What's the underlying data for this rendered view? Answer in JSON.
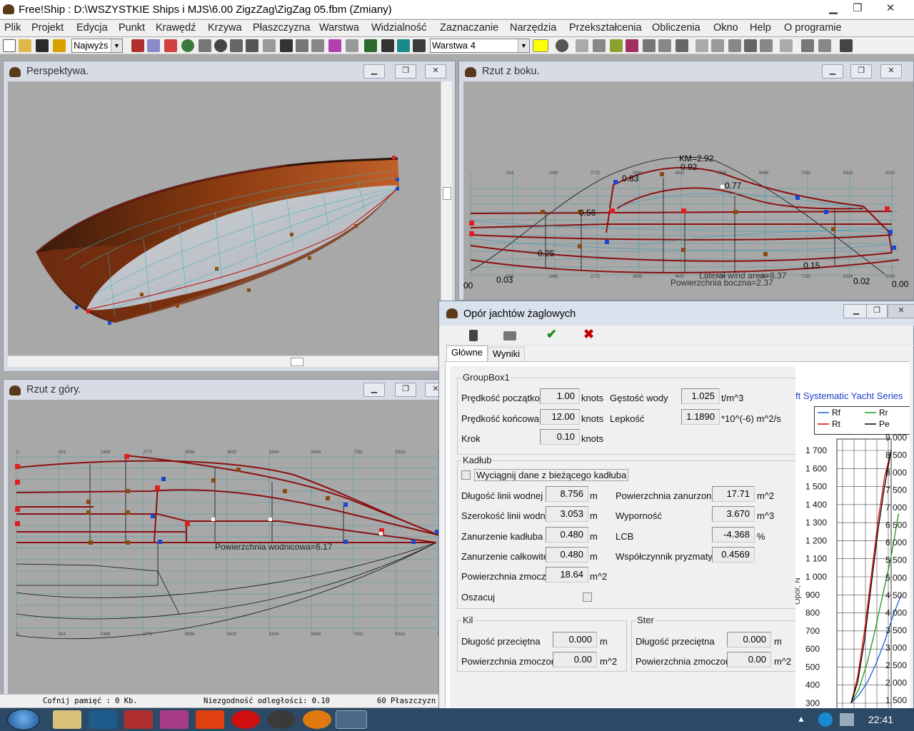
{
  "app": {
    "title": "Free!Ship  : D:\\WSZYSTKIE Ships i MJS\\6.00 ZigzZag\\ZigZag 05.fbm (Zmiany)",
    "min": "▁",
    "max": "❐",
    "close": "✕"
  },
  "menu": [
    "Plik",
    "Projekt",
    "Edycja",
    "Punkt",
    "Krawędź",
    "Krzywa",
    "Płaszczyzna",
    "Warstwa",
    "Widzialność",
    "Zaznaczanie",
    "Narzędzia",
    "Przekształcenia",
    "Obliczenia",
    "Okno",
    "Help",
    "O programie"
  ],
  "toolbar": {
    "combo1": "Najwyżs",
    "combo2": "Warstwa 4",
    "color_swatch": "#ffff00"
  },
  "views": {
    "perspective": {
      "title": "Perspektywa."
    },
    "side": {
      "title": "Rzut z boku.",
      "labels": {
        "km": "KM=2.92",
        "v092": "0.92",
        "v083": "0.83",
        "v077": "0.77",
        "v056": "0.56",
        "v025": "0.25",
        "v003": "0.03",
        "v015": "0.15",
        "v002": "0.02",
        "v000": "0.00",
        "v00": "00",
        "lateral": "Lateral wind area=8.37",
        "pow": "Powierzchnia boczna=2.37"
      },
      "ticks": [
        "924",
        "1848",
        "2772",
        "3696",
        "4620",
        "5544",
        "6468",
        "7392",
        "8316",
        "9240"
      ]
    },
    "top": {
      "title": "Rzut z góry.",
      "label": "Powierzchnia wodnicowa=6.17",
      "ticks": [
        "0",
        "924",
        "1848",
        "2772",
        "3696",
        "4620",
        "5544",
        "6468",
        "7392",
        "8316",
        "9240"
      ]
    }
  },
  "status": {
    "undo": "Cofnij pamięć : 0 Kb.",
    "mismatch": "Niezgodność odległości: 0.10",
    "surfaces": "60 Płaszczyzn"
  },
  "dialog": {
    "title": "Opór jachtów żaglowych",
    "tabs": [
      "Główne",
      "Wyniki"
    ],
    "groupbox1": {
      "title": "GroupBox1",
      "speed_start_label": "Prędkość początkowa",
      "speed_start": "1.00",
      "speed_start_unit": "knots",
      "speed_end_label": "Prędkość końcowa",
      "speed_end": "12.00",
      "speed_end_unit": "knots",
      "step_label": "Krok",
      "step": "0.10",
      "step_unit": "knots",
      "density_label": "Gęstość wody",
      "density": "1.025",
      "density_unit": "t/m^3",
      "viscosity_label": "Lepkość",
      "viscosity": "1.1890",
      "viscosity_unit": "*10^(-6) m^2/s"
    },
    "hull": {
      "title": "Kadłub",
      "extract_label": "Wyciągnij dane z bieżącego kadłuba",
      "lwl_label": "Długość linii wodnej",
      "lwl": "8.756",
      "lwl_unit": "m",
      "bwl_label": "Szerokość linii wodnej",
      "bwl": "3.053",
      "bwl_unit": "m",
      "tc_label": "Zanurzenie kadłuba",
      "tc": "0.480",
      "tc_unit": "m",
      "t_label": "Zanurzenie całkowite",
      "t": "0.480",
      "t_unit": "m",
      "ws_label": "Powierzchnia zmoczona",
      "ws": "18.64",
      "ws_unit": "m^2",
      "estimate_label": "Oszacuj",
      "aw_label": "Powierzchnia zanurzona",
      "aw": "17.71",
      "aw_unit": "m^2",
      "disp_label": "Wyporność",
      "disp": "3.670",
      "disp_unit": "m^3",
      "lcb_label": "LCB",
      "lcb": "-4.368",
      "lcb_unit": "%",
      "cp_label": "Współczynnik pryzmatyczny",
      "cp": "0.4569"
    },
    "keel": {
      "title": "Kil",
      "len_label": "Długość przeciętna",
      "len": "0.000",
      "len_unit": "m",
      "area_label": "Powierzchnia zmoczona",
      "area": "0.00",
      "area_unit": "m^2"
    },
    "rudder": {
      "title": "Ster",
      "len_label": "Długość przeciętna",
      "len": "0.000",
      "len_unit": "m",
      "area_label": "Powierzchnia zmoczona",
      "area": "0.00",
      "area_unit": "m^2"
    },
    "chart_title": "ft Systematic Yacht Series",
    "legend": [
      {
        "name": "Rf",
        "color": "#1f5fd1"
      },
      {
        "name": "Rr",
        "color": "#1a9a1a"
      },
      {
        "name": "Rt",
        "color": "#e00000"
      },
      {
        "name": "Pe",
        "color": "#000000"
      }
    ],
    "y_axis_label": "Opór, N",
    "left_ticks": [
      "1 700",
      "1 600",
      "1 500",
      "1 400",
      "1 300",
      "1 200",
      "1 100",
      "1 000",
      "900",
      "800",
      "700",
      "600",
      "500",
      "400",
      "300"
    ],
    "right_ticks": [
      "9 000",
      "8 500",
      "8 000",
      "7 500",
      "7 000",
      "6 500",
      "6 000",
      "5 500",
      "5 000",
      "4 500",
      "4 000",
      "3 500",
      "3 000",
      "2 500",
      "2 000",
      "1 500"
    ]
  },
  "chart_data": {
    "type": "line",
    "title": "ft Systematic Yacht Series",
    "ylabel": "Opór, N",
    "ylim_left": [
      300,
      1700
    ],
    "ylim_right": [
      1500,
      9000
    ],
    "series": [
      {
        "name": "Rf",
        "values": [
          300,
          350,
          420,
          520,
          640,
          780,
          900
        ]
      },
      {
        "name": "Rr",
        "values": [
          300,
          380,
          520,
          700,
          900,
          1100,
          1350
        ]
      },
      {
        "name": "Rt",
        "values": [
          300,
          450,
          700,
          1000,
          1300,
          1550,
          1700
        ]
      },
      {
        "name": "Pe",
        "values": [
          300,
          420,
          650,
          950,
          1250,
          1500,
          1700
        ]
      }
    ]
  },
  "taskbar": {
    "time": "22:41"
  }
}
